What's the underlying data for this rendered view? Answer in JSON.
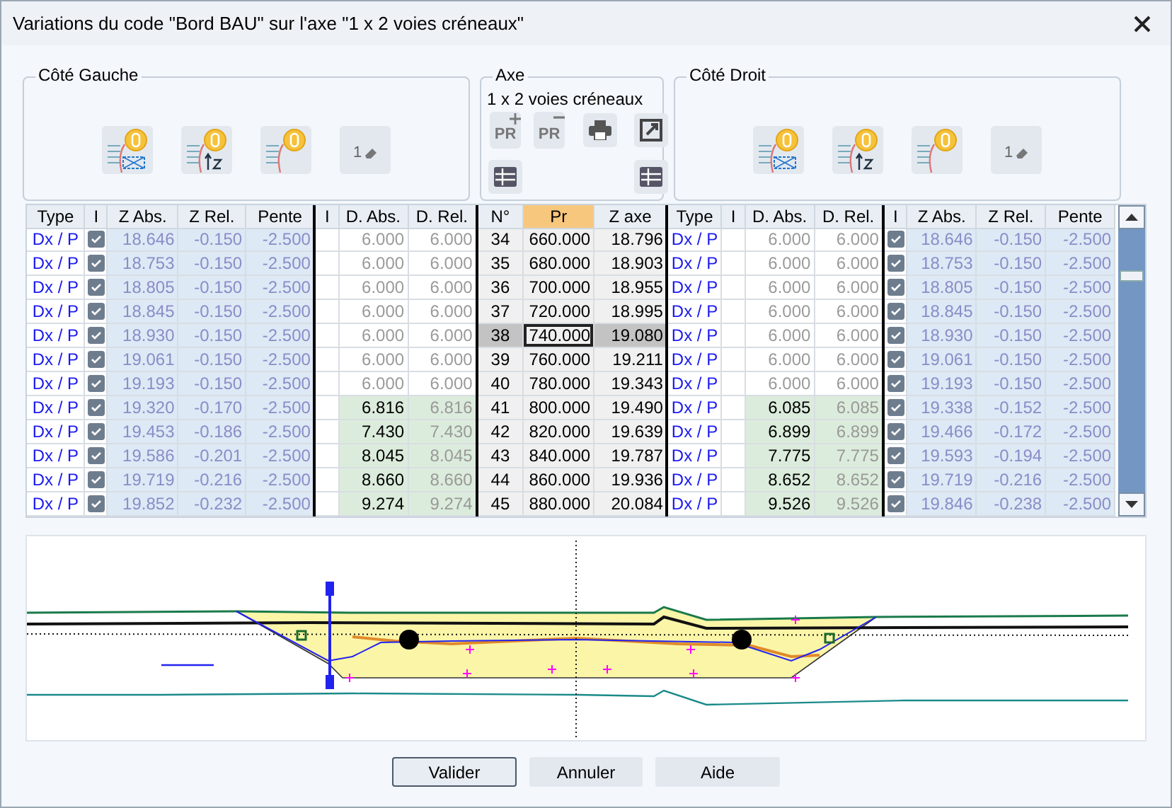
{
  "window": {
    "title": "Variations du code \"Bord BAU\" sur l'axe \"1 x 2 voies créneaux\""
  },
  "groups": [
    {
      "title": "Côté Gauche",
      "tools": [
        {
          "kind": "offset-profile"
        },
        {
          "kind": "z-profile"
        },
        {
          "kind": "curve-profile"
        },
        {
          "kind": "eraser",
          "label": "1"
        }
      ]
    },
    {
      "title": "Axe",
      "subtitle": "1 x 2 voies créneaux",
      "tools": [
        {
          "kind": "pr-add",
          "label": "PR"
        },
        {
          "kind": "pr-remove",
          "label": "PR"
        },
        {
          "kind": "print"
        },
        {
          "kind": "export"
        },
        {
          "kind": "table"
        },
        {
          "kind": "table"
        }
      ]
    },
    {
      "title": "Côté Droit",
      "tools": [
        {
          "kind": "offset-profile"
        },
        {
          "kind": "z-profile"
        },
        {
          "kind": "curve-profile"
        },
        {
          "kind": "eraser",
          "label": "1"
        }
      ]
    }
  ],
  "table": {
    "columns": [
      "Type",
      "I",
      "Z Abs.",
      "Z Rel.",
      "Pente",
      "I",
      "D. Abs.",
      "D. Rel.",
      "N°",
      "Pr",
      "Z axe",
      "Type",
      "I",
      "D. Abs.",
      "D. Rel.",
      "I",
      "Z Abs.",
      "Z Rel.",
      "Pente"
    ],
    "rows": [
      {
        "n": "34",
        "pr": "660.000",
        "z_axe": "18.796",
        "selected": false,
        "left": {
          "type": "Dx / P",
          "checked": true,
          "z_abs": "18.646",
          "z_rel": "-0.150",
          "pente": "-2.500",
          "d_abs": "6.000",
          "d_rel": "6.000",
          "edited": false
        },
        "right": {
          "type": "Dx / P",
          "checked": true,
          "z_abs": "18.646",
          "z_rel": "-0.150",
          "pente": "-2.500",
          "d_abs": "6.000",
          "d_rel": "6.000",
          "edited": false
        }
      },
      {
        "n": "35",
        "pr": "680.000",
        "z_axe": "18.903",
        "selected": false,
        "left": {
          "type": "Dx / P",
          "checked": true,
          "z_abs": "18.753",
          "z_rel": "-0.150",
          "pente": "-2.500",
          "d_abs": "6.000",
          "d_rel": "6.000",
          "edited": false
        },
        "right": {
          "type": "Dx / P",
          "checked": true,
          "z_abs": "18.753",
          "z_rel": "-0.150",
          "pente": "-2.500",
          "d_abs": "6.000",
          "d_rel": "6.000",
          "edited": false
        }
      },
      {
        "n": "36",
        "pr": "700.000",
        "z_axe": "18.955",
        "selected": false,
        "left": {
          "type": "Dx / P",
          "checked": true,
          "z_abs": "18.805",
          "z_rel": "-0.150",
          "pente": "-2.500",
          "d_abs": "6.000",
          "d_rel": "6.000",
          "edited": false
        },
        "right": {
          "type": "Dx / P",
          "checked": true,
          "z_abs": "18.805",
          "z_rel": "-0.150",
          "pente": "-2.500",
          "d_abs": "6.000",
          "d_rel": "6.000",
          "edited": false
        }
      },
      {
        "n": "37",
        "pr": "720.000",
        "z_axe": "18.995",
        "selected": false,
        "left": {
          "type": "Dx / P",
          "checked": true,
          "z_abs": "18.845",
          "z_rel": "-0.150",
          "pente": "-2.500",
          "d_abs": "6.000",
          "d_rel": "6.000",
          "edited": false
        },
        "right": {
          "type": "Dx / P",
          "checked": true,
          "z_abs": "18.845",
          "z_rel": "-0.150",
          "pente": "-2.500",
          "d_abs": "6.000",
          "d_rel": "6.000",
          "edited": false
        }
      },
      {
        "n": "38",
        "pr": "740.000",
        "z_axe": "19.080",
        "selected": true,
        "left": {
          "type": "Dx / P",
          "checked": true,
          "z_abs": "18.930",
          "z_rel": "-0.150",
          "pente": "-2.500",
          "d_abs": "6.000",
          "d_rel": "6.000",
          "edited": false
        },
        "right": {
          "type": "Dx / P",
          "checked": true,
          "z_abs": "18.930",
          "z_rel": "-0.150",
          "pente": "-2.500",
          "d_abs": "6.000",
          "d_rel": "6.000",
          "edited": false
        }
      },
      {
        "n": "39",
        "pr": "760.000",
        "z_axe": "19.211",
        "selected": false,
        "left": {
          "type": "Dx / P",
          "checked": true,
          "z_abs": "19.061",
          "z_rel": "-0.150",
          "pente": "-2.500",
          "d_abs": "6.000",
          "d_rel": "6.000",
          "edited": false
        },
        "right": {
          "type": "Dx / P",
          "checked": true,
          "z_abs": "19.061",
          "z_rel": "-0.150",
          "pente": "-2.500",
          "d_abs": "6.000",
          "d_rel": "6.000",
          "edited": false
        }
      },
      {
        "n": "40",
        "pr": "780.000",
        "z_axe": "19.343",
        "selected": false,
        "left": {
          "type": "Dx / P",
          "checked": true,
          "z_abs": "19.193",
          "z_rel": "-0.150",
          "pente": "-2.500",
          "d_abs": "6.000",
          "d_rel": "6.000",
          "edited": false
        },
        "right": {
          "type": "Dx / P",
          "checked": true,
          "z_abs": "19.193",
          "z_rel": "-0.150",
          "pente": "-2.500",
          "d_abs": "6.000",
          "d_rel": "6.000",
          "edited": false
        }
      },
      {
        "n": "41",
        "pr": "800.000",
        "z_axe": "19.490",
        "selected": false,
        "left": {
          "type": "Dx / P",
          "checked": true,
          "z_abs": "19.320",
          "z_rel": "-0.170",
          "pente": "-2.500",
          "d_abs": "6.816",
          "d_rel": "6.816",
          "edited": true
        },
        "right": {
          "type": "Dx / P",
          "checked": true,
          "z_abs": "19.338",
          "z_rel": "-0.152",
          "pente": "-2.500",
          "d_abs": "6.085",
          "d_rel": "6.085",
          "edited": true
        }
      },
      {
        "n": "42",
        "pr": "820.000",
        "z_axe": "19.639",
        "selected": false,
        "left": {
          "type": "Dx / P",
          "checked": true,
          "z_abs": "19.453",
          "z_rel": "-0.186",
          "pente": "-2.500",
          "d_abs": "7.430",
          "d_rel": "7.430",
          "edited": true
        },
        "right": {
          "type": "Dx / P",
          "checked": true,
          "z_abs": "19.466",
          "z_rel": "-0.172",
          "pente": "-2.500",
          "d_abs": "6.899",
          "d_rel": "6.899",
          "edited": true
        }
      },
      {
        "n": "43",
        "pr": "840.000",
        "z_axe": "19.787",
        "selected": false,
        "left": {
          "type": "Dx / P",
          "checked": true,
          "z_abs": "19.586",
          "z_rel": "-0.201",
          "pente": "-2.500",
          "d_abs": "8.045",
          "d_rel": "8.045",
          "edited": true
        },
        "right": {
          "type": "Dx / P",
          "checked": true,
          "z_abs": "19.593",
          "z_rel": "-0.194",
          "pente": "-2.500",
          "d_abs": "7.775",
          "d_rel": "7.775",
          "edited": true
        }
      },
      {
        "n": "44",
        "pr": "860.000",
        "z_axe": "19.936",
        "selected": false,
        "left": {
          "type": "Dx / P",
          "checked": true,
          "z_abs": "19.719",
          "z_rel": "-0.216",
          "pente": "-2.500",
          "d_abs": "8.660",
          "d_rel": "8.660",
          "edited": true
        },
        "right": {
          "type": "Dx / P",
          "checked": true,
          "z_abs": "19.719",
          "z_rel": "-0.216",
          "pente": "-2.500",
          "d_abs": "8.652",
          "d_rel": "8.652",
          "edited": true
        }
      },
      {
        "n": "45",
        "pr": "880.000",
        "z_axe": "20.084",
        "selected": false,
        "left": {
          "type": "Dx / P",
          "checked": true,
          "z_abs": "19.852",
          "z_rel": "-0.232",
          "pente": "-2.500",
          "d_abs": "9.274",
          "d_rel": "9.274",
          "edited": true
        },
        "right": {
          "type": "Dx / P",
          "checked": true,
          "z_abs": "19.846",
          "z_rel": "-0.238",
          "pente": "-2.500",
          "d_abs": "9.526",
          "d_rel": "9.526",
          "edited": true
        }
      }
    ]
  },
  "buttons": [
    {
      "label": "Valider",
      "default": true
    },
    {
      "label": "Annuler",
      "default": false
    },
    {
      "label": "Aide",
      "default": false
    }
  ]
}
